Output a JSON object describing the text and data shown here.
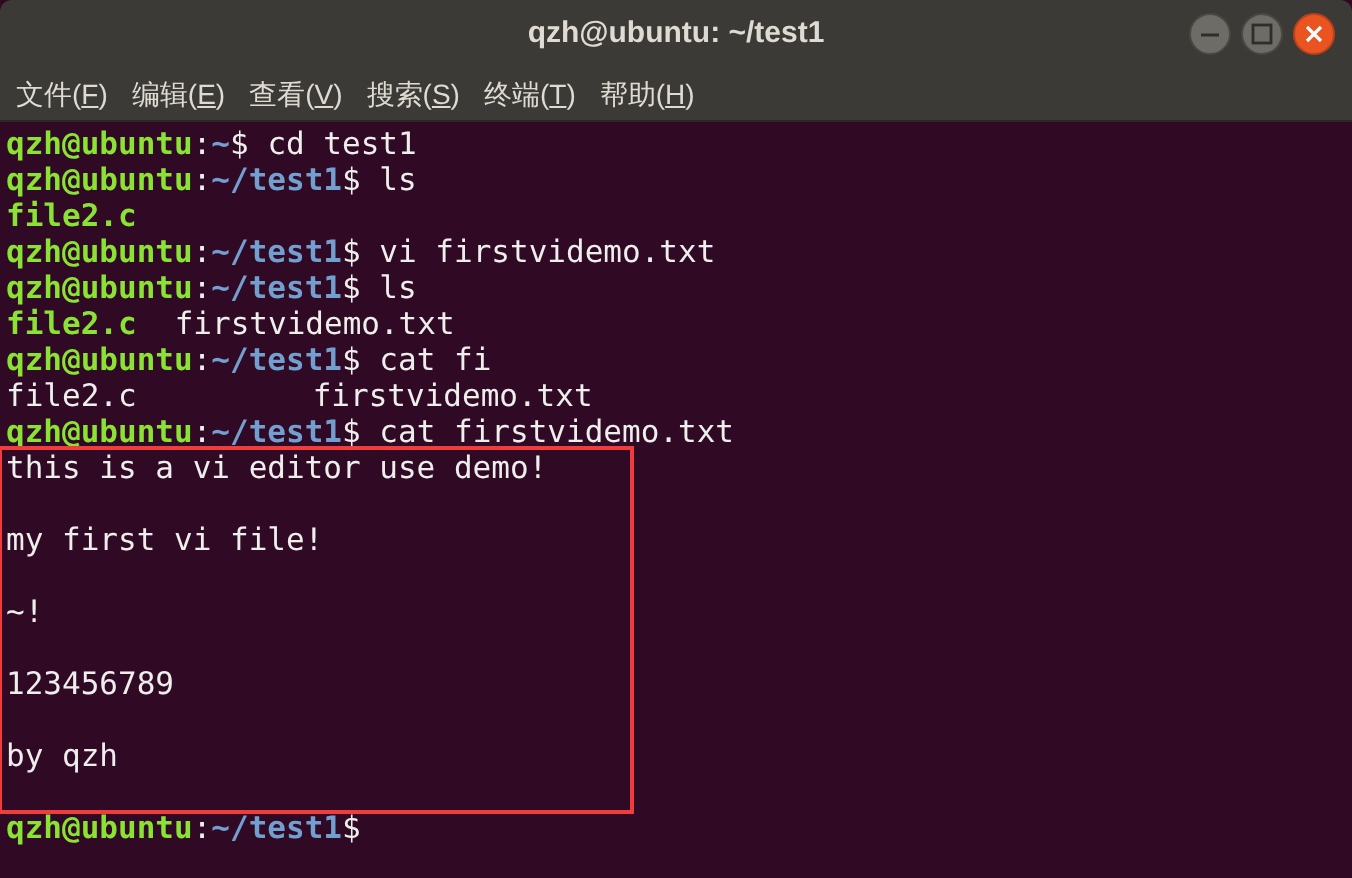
{
  "window": {
    "title": "qzh@ubuntu: ~/test1"
  },
  "menu": [
    {
      "label": "文件(F)"
    },
    {
      "label": "编辑(E)"
    },
    {
      "label": "查看(V)"
    },
    {
      "label": "搜索(S)"
    },
    {
      "label": "终端(T)"
    },
    {
      "label": "帮助(H)"
    }
  ],
  "terminal": {
    "lines": [
      {
        "kind": "prompt",
        "user": "qzh@ubuntu",
        "separator": ":",
        "path": "~",
        "sign": "$",
        "command": "cd test1"
      },
      {
        "kind": "prompt",
        "user": "qzh@ubuntu",
        "separator": ":",
        "path": "~/test1",
        "sign": "$",
        "command": "ls"
      },
      {
        "kind": "output",
        "segments": [
          {
            "text": "file2.c",
            "color": "#8ae234"
          }
        ]
      },
      {
        "kind": "prompt",
        "user": "qzh@ubuntu",
        "separator": ":",
        "path": "~/test1",
        "sign": "$",
        "command": "vi firstvidemo.txt"
      },
      {
        "kind": "prompt",
        "user": "qzh@ubuntu",
        "separator": ":",
        "path": "~/test1",
        "sign": "$",
        "command": "ls"
      },
      {
        "kind": "output",
        "segments": [
          {
            "text": "file2.c",
            "color": "#8ae234"
          },
          {
            "text": "firstvidemo.txt",
            "color": "#eeeeec"
          }
        ]
      },
      {
        "kind": "prompt",
        "user": "qzh@ubuntu",
        "separator": ":",
        "path": "~/test1",
        "sign": "$",
        "command": "cat fi"
      },
      {
        "kind": "output",
        "segments": [
          {
            "text": "file2.c",
            "color": "#eeeeec"
          },
          {
            "text": "firstvidemo.txt",
            "color": "#eeeeec"
          }
        ]
      },
      {
        "kind": "prompt",
        "user": "qzh@ubuntu",
        "separator": ":",
        "path": "~/test1",
        "sign": "$",
        "command": "cat firstvidemo.txt"
      },
      {
        "kind": "highlight",
        "lines": [
          {
            "kind": "output",
            "segments": [
              {
                "text": "this is a vi editor use demo!",
                "color": "#eeeeec"
              }
            ]
          },
          {
            "kind": "blank"
          },
          {
            "kind": "output",
            "segments": [
              {
                "text": "my first vi file!",
                "color": "#eeeeec"
              }
            ]
          },
          {
            "kind": "blank"
          },
          {
            "kind": "output",
            "segments": [
              {
                "text": "~!",
                "color": "#eeeeec"
              }
            ]
          },
          {
            "kind": "blank"
          },
          {
            "kind": "output",
            "segments": [
              {
                "text": "123456789",
                "color": "#eeeeec"
              }
            ]
          },
          {
            "kind": "blank"
          },
          {
            "kind": "output",
            "segments": [
              {
                "text": "by qzh",
                "color": "#eeeeec"
              }
            ]
          },
          {
            "kind": "blank"
          }
        ]
      },
      {
        "kind": "prompt",
        "user": "qzh@ubuntu",
        "separator": ":",
        "path": "~/test1",
        "sign": "$"
      }
    ]
  }
}
